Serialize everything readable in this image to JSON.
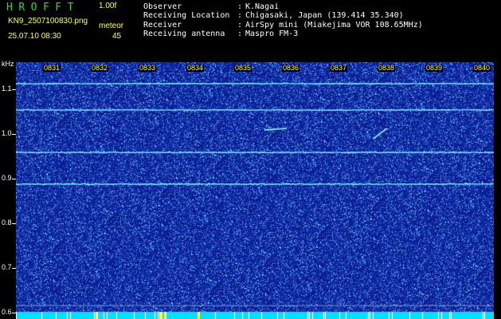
{
  "app": {
    "title": "HROFFT",
    "version": "1.00f",
    "filename": "KN9_2507100830.png",
    "mode": "meteor",
    "datetime": "25.07.10 08:30",
    "count": "45"
  },
  "info": [
    {
      "label": "Observer",
      "value": "K.Nagai"
    },
    {
      "label": "Receiving Location",
      "value": "Chigasaki, Japan (139.414 35.340)"
    },
    {
      "label": "Receiver",
      "value": "AirSpy mini (Miakejima VOR 108.65MHz)"
    },
    {
      "label": "Receiving antenna",
      "value": "Maspro FM-3"
    }
  ],
  "axis": {
    "unit": "kHz",
    "y_ticks": [
      "1.1",
      "1.0",
      "0.9",
      "0.8",
      "0.7",
      "0.6"
    ],
    "y_values": [
      1.1,
      1.0,
      0.9,
      0.8,
      0.7,
      0.6
    ],
    "y_range": [
      0.585,
      1.16
    ],
    "x_ticks": [
      "0831",
      "0832",
      "0833",
      "0834",
      "0835",
      "0836",
      "0837",
      "0838",
      "0839",
      "0840"
    ],
    "x_range": [
      "0830",
      "0840"
    ]
  },
  "signals": {
    "carrier_lines_khz": [
      1.112,
      1.053,
      0.958,
      0.887
    ],
    "faint_lines_khz": [
      0.615,
      0.6
    ],
    "meteor_echoes": [
      {
        "time": "08:35.6",
        "freq_khz": 1.01
      },
      {
        "time": "08:37.9",
        "freq_khz": 1.0
      }
    ]
  },
  "colors": {
    "background": "#0a1a8c",
    "noise": "#3fa0ff",
    "carrier": "#7ff0ff",
    "title": "#3fcf3f",
    "header_text": "#ffff66",
    "bottom_band": "#00e0ff"
  }
}
